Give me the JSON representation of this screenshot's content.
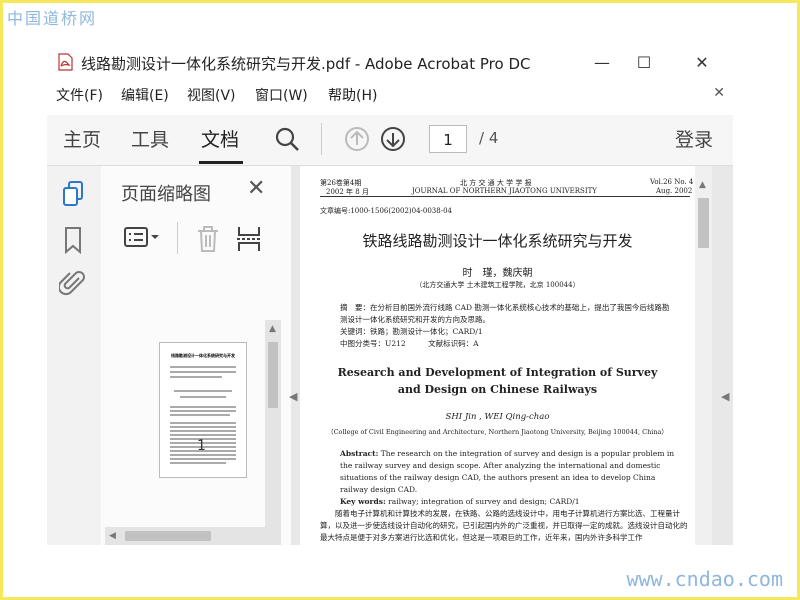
{
  "watermarks": {
    "top_left": "中国道桥网",
    "bottom_right": "www.cndao.com"
  },
  "window": {
    "title": "线路勘测设计一体化系统研究与开发.pdf - Adobe Acrobat Pro DC",
    "controls": {
      "minimize": "—",
      "maximize": "☐",
      "close": "✕"
    }
  },
  "menu": {
    "items": [
      "文件(F)",
      "编辑(E)",
      "视图(V)",
      "窗口(W)",
      "帮助(H)"
    ],
    "close": "✕"
  },
  "toolbar": {
    "tabs": [
      "主页",
      "工具",
      "文档"
    ],
    "active_tab": "文档",
    "page_current": "1",
    "page_total": "/ 4",
    "login": "登录",
    "icons": [
      "search-icon",
      "page-up-icon",
      "page-down-icon"
    ]
  },
  "thumbnails": {
    "title": "页面缩略图",
    "close": "✕",
    "first_label": "1",
    "icons": [
      "options-menu-icon",
      "trash-icon",
      "extract-page-icon"
    ],
    "thumb1_title": "线路勘测设计一体化系统研究与开发"
  },
  "left_rail_icons": [
    "page-thumbnails-icon",
    "bookmark-icon",
    "attachment-icon"
  ],
  "document": {
    "header_left1": "第26卷第4期",
    "header_left2": "2002 年 8 月",
    "header_center1": "北 方 交 通 大 学 学 报",
    "header_center2": "JOURNAL OF NORTHERN JIAOTONG UNIVERSITY",
    "header_right1": "Vol.26 No. 4",
    "header_right2": "Aug. 2002",
    "article_no": "文章编号:1000-1506(2002)04-0038-04",
    "title_cn": "铁路线路勘测设计一体化系统研究与开发",
    "authors_cn": "时　瑾，魏庆朝",
    "affil_cn": "（北方交通大学 土木建筑工程学院，北京 100044）",
    "abstract_cn": "摘　要：在分析目前国外流行线路 CAD 勘测一体化系统核心技术的基础上，提出了我国今后线路勘测设计一体化系统研究和开发的方向及思路。",
    "keywords_cn": "关键词：铁路；勘测设计一体化；CARD/1",
    "classification_cn": "中图分类号：U212　　　文献标识码：A",
    "title_en_1": "Research and Development of Integration of Survey",
    "title_en_2": "and Design on Chinese Railways",
    "authors_en": "SHI Jin , WEI Qing-chao",
    "affil_en": "（College of Civil Engineering and Architecture, Northern Jiaotong University, Beijing 100044, China）",
    "abstract_en_label": "Abstract:",
    "abstract_en": "The research on the integration of survey and design is a popular problem in the railway survey and design scope. After analyzing the international and domestic situations of the railway design CAD, the authors present an idea to develop China railway design CAD.",
    "keywords_en_label": "Key words:",
    "keywords_en": "railway; integration of survey and design; CARD/1",
    "body": "随着电子计算机和计算技术的发展，在铁路、公路的选线设计中，用电子计算机进行方案比选、工程量计算，以及进一步使选线设计自动化的研究，已引起国内外的广泛重视，并已取得一定的成就。选线设计自动化的最大特点是便于对多方案进行比选和优化，但这是一项艰巨的工作，近年来，国内外许多科学工作"
  },
  "colors": {
    "accent": "#2b77c8",
    "frame": "#f5e85a",
    "watermark": "#8fb7de"
  }
}
